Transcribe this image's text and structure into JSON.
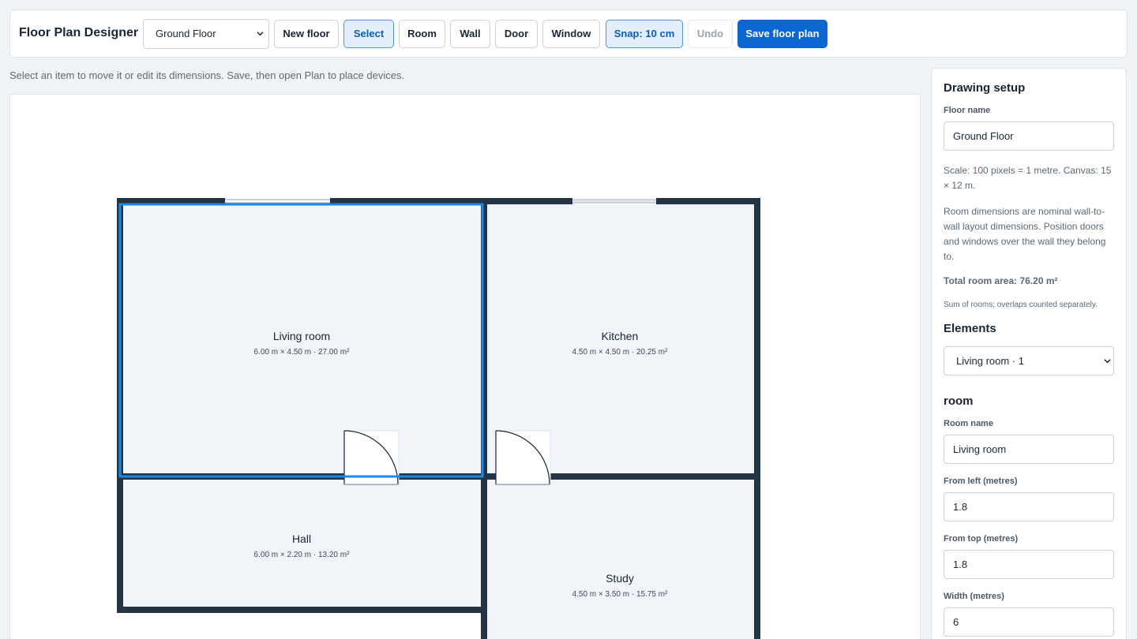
{
  "toolbar": {
    "title": "Floor Plan Designer",
    "floor_select_value": "Ground Floor",
    "buttons": {
      "new_floor": "New floor",
      "select": "Select",
      "room": "Room",
      "wall": "Wall",
      "door": "Door",
      "window": "Window",
      "snap": "Snap: 10 cm",
      "undo": "Undo",
      "save": "Save floor plan"
    }
  },
  "hint": "Select an item to move it or edit its dimensions. Save, then open Plan to place devices.",
  "canvas": {
    "rooms": [
      {
        "name": "Living room",
        "dims": "6.00 m × 4.50 m · 27.00 m²",
        "selected": true
      },
      {
        "name": "Kitchen",
        "dims": "4.50 m × 4.50 m · 20.25 m²",
        "selected": false
      },
      {
        "name": "Hall",
        "dims": "6.00 m × 2.20 m · 13.20 m²",
        "selected": false
      },
      {
        "name": "Study",
        "dims": "4.50 m × 3.50 m · 15.75 m²",
        "selected": false
      }
    ]
  },
  "panel": {
    "setup_heading": "Drawing setup",
    "floor_name_label": "Floor name",
    "floor_name_value": "Ground Floor",
    "scale_text": "Scale: 100 pixels = 1 metre. Canvas: 15 × 12 m.",
    "dims_text": "Room dimensions are nominal wall-to-wall layout dimensions. Position doors and windows over the wall they belong to.",
    "total_area": "Total room area: 76.20 m²",
    "total_note": "Sum of rooms; overlaps counted separately.",
    "elements_heading": "Elements",
    "element_select_value": "Living room · 1",
    "type_heading": "room",
    "room_name_label": "Room name",
    "room_name_value": "Living room",
    "left_label": "From left (metres)",
    "left_value": "1.8",
    "top_label": "From top (metres)",
    "top_value": "1.8",
    "width_label": "Width (metres)",
    "width_value": "6"
  },
  "colors": {
    "wall": "#243444",
    "room_fill": "#f1f5f9",
    "selection": "#1e88e5",
    "primary": "#0d66d0"
  }
}
